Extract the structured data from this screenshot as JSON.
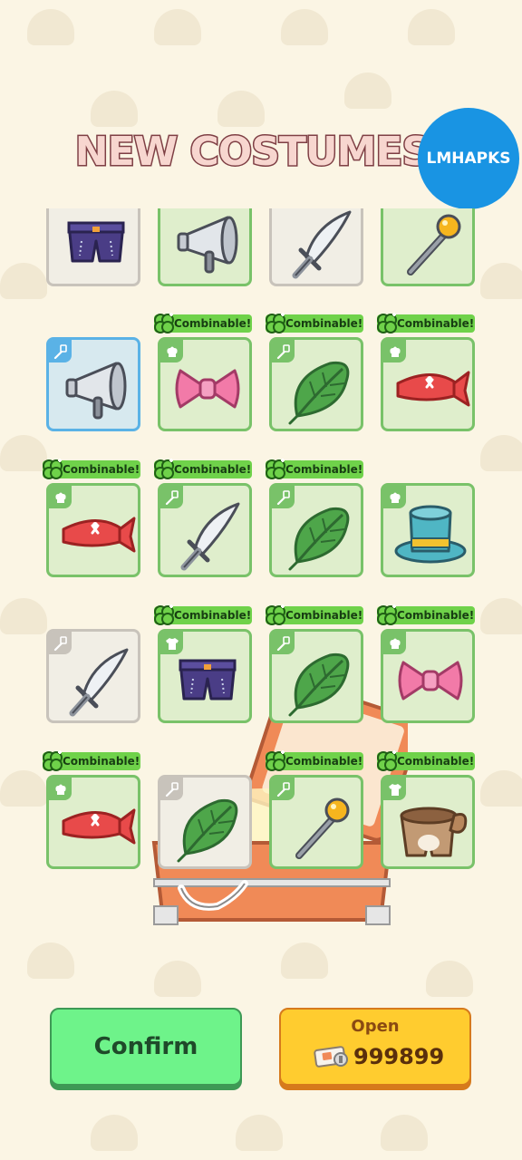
{
  "header": {
    "title": "NEW COSTUMES!",
    "watermark": "LMHAPKS"
  },
  "badge_text": "Combinable!",
  "items": [
    {
      "item": "shorts",
      "category": "hat",
      "state": "grey",
      "combinable": false
    },
    {
      "item": "megaphone",
      "category": "hat",
      "state": "green",
      "combinable": false
    },
    {
      "item": "sword",
      "category": "spatula",
      "state": "grey",
      "combinable": false
    },
    {
      "item": "magic-wand",
      "category": "spatula",
      "state": "green",
      "combinable": false
    },
    {
      "item": "megaphone",
      "category": "spatula",
      "state": "blue",
      "combinable": false
    },
    {
      "item": "bow",
      "category": "hat",
      "state": "green",
      "combinable": true
    },
    {
      "item": "leaf",
      "category": "spatula",
      "state": "green",
      "combinable": true
    },
    {
      "item": "bandana",
      "category": "hat",
      "state": "green",
      "combinable": true
    },
    {
      "item": "bandana",
      "category": "hat",
      "state": "green",
      "combinable": true
    },
    {
      "item": "sword",
      "category": "spatula",
      "state": "green",
      "combinable": true
    },
    {
      "item": "leaf",
      "category": "spatula",
      "state": "green",
      "combinable": true
    },
    {
      "item": "top-hat",
      "category": "hat",
      "state": "green",
      "combinable": false
    },
    {
      "item": "sword",
      "category": "spatula",
      "state": "grey",
      "combinable": false
    },
    {
      "item": "shorts",
      "category": "shirt",
      "state": "green",
      "combinable": true
    },
    {
      "item": "leaf",
      "category": "spatula",
      "state": "green",
      "combinable": true
    },
    {
      "item": "bow",
      "category": "hat",
      "state": "green",
      "combinable": true
    },
    {
      "item": "bandana",
      "category": "hat",
      "state": "green",
      "combinable": true
    },
    {
      "item": "leaf",
      "category": "spatula",
      "state": "grey",
      "combinable": false
    },
    {
      "item": "magic-wand",
      "category": "spatula",
      "state": "green",
      "combinable": true
    },
    {
      "item": "bear-tail-shorts",
      "category": "shirt",
      "state": "green",
      "combinable": true
    }
  ],
  "footer": {
    "confirm_label": "Confirm",
    "open_label": "Open",
    "open_cost": "999899",
    "open_cost_icon": "ticket-icon"
  },
  "colors": {
    "combinable": "#6fd24a",
    "card_owned": "#79c269",
    "card_grey": "#c8c3bb",
    "card_selected": "#5ab2e6",
    "confirm": "#6ef38a",
    "open": "#ffcc2f"
  }
}
